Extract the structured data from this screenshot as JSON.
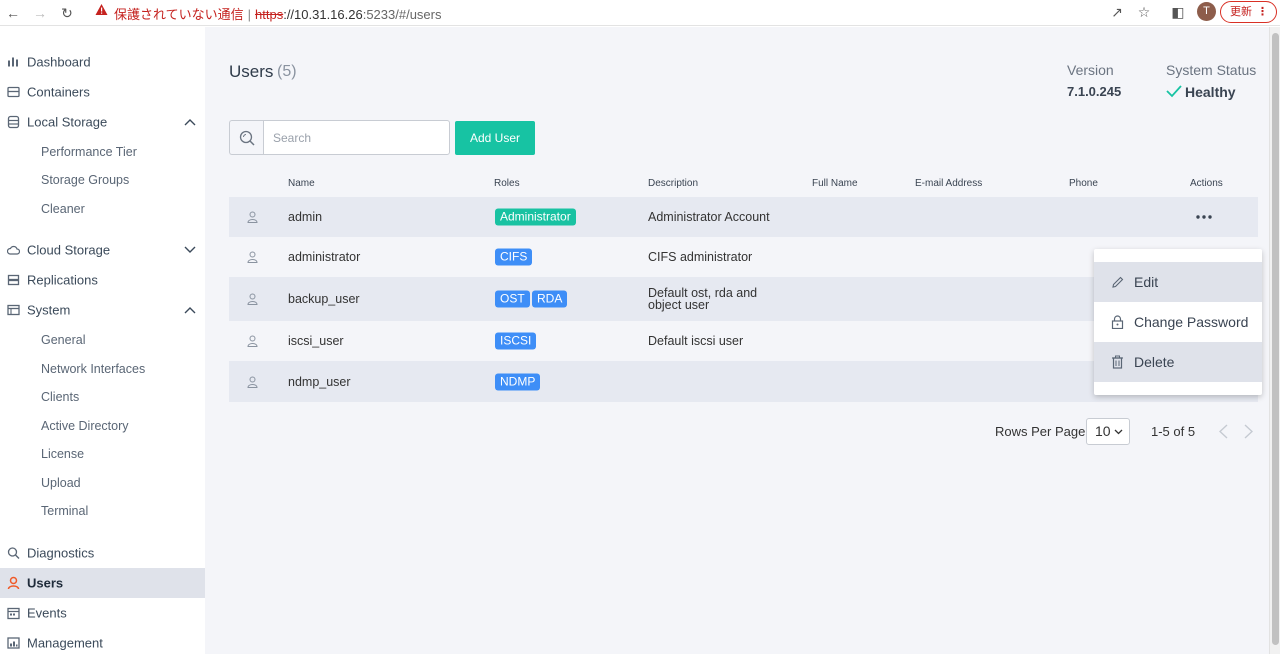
{
  "browser": {
    "insecure_label": "保護されていない通信",
    "url_scheme": "https",
    "url_host": "://10.31.16.26",
    "url_path": ":5233/#/users",
    "avatar_initial": "T",
    "update_label": "更新"
  },
  "sidebar": {
    "items": [
      {
        "label": "Dashboard",
        "icon": "bar-chart-icon"
      },
      {
        "label": "Containers",
        "icon": "container-icon"
      },
      {
        "label": "Local Storage",
        "icon": "database-icon"
      },
      {
        "label": "Cloud Storage",
        "icon": "cloud-icon"
      },
      {
        "label": "Replications",
        "icon": "replication-icon"
      },
      {
        "label": "System",
        "icon": "window-icon"
      },
      {
        "label": "Diagnostics",
        "icon": "magnifier-icon"
      },
      {
        "label": "Users",
        "icon": "user-icon"
      },
      {
        "label": "Events",
        "icon": "calendar-icon"
      },
      {
        "label": "Management",
        "icon": "management-icon"
      }
    ],
    "local_storage_sub": [
      "Performance Tier",
      "Storage Groups",
      "Cleaner"
    ],
    "system_sub": [
      "General",
      "Network Interfaces",
      "Clients",
      "Active Directory",
      "License",
      "Upload",
      "Terminal"
    ],
    "active": "Users",
    "accent_color": "#f05a28"
  },
  "header": {
    "title": "Users",
    "count": "(5)",
    "version_label": "Version",
    "version_value": "7.1.0.245",
    "status_label": "System Status",
    "status_value": "Healthy",
    "status_color": "#17c3a3"
  },
  "toolbar": {
    "search_placeholder": "Search",
    "add_user_label": "Add User"
  },
  "table": {
    "columns": [
      "Name",
      "Roles",
      "Description",
      "Full Name",
      "E-mail Address",
      "Phone",
      "Actions"
    ],
    "rows": [
      {
        "name": "admin",
        "roles": [
          "Administrator"
        ],
        "description": "Administrator Account",
        "full_name": "",
        "email": "",
        "phone": ""
      },
      {
        "name": "administrator",
        "roles": [
          "CIFS"
        ],
        "description": "CIFS administrator",
        "full_name": "",
        "email": "",
        "phone": ""
      },
      {
        "name": "backup_user",
        "roles": [
          "OST",
          "RDA"
        ],
        "description": "Default ost, rda and object user",
        "full_name": "",
        "email": "",
        "phone": ""
      },
      {
        "name": "iscsi_user",
        "roles": [
          "ISCSI"
        ],
        "description": "Default iscsi user",
        "full_name": "",
        "email": "",
        "phone": ""
      },
      {
        "name": "ndmp_user",
        "roles": [
          "NDMP"
        ],
        "description": "",
        "full_name": "",
        "email": "",
        "phone": ""
      }
    ]
  },
  "action_menu": {
    "items": [
      {
        "label": "Edit",
        "icon": "pencil-icon"
      },
      {
        "label": "Change Password",
        "icon": "lock-icon"
      },
      {
        "label": "Delete",
        "icon": "trash-icon"
      }
    ]
  },
  "pagination": {
    "rows_per_page_label": "Rows Per Page",
    "rows_per_page_value": "10",
    "range_label": "1-5 of 5"
  }
}
